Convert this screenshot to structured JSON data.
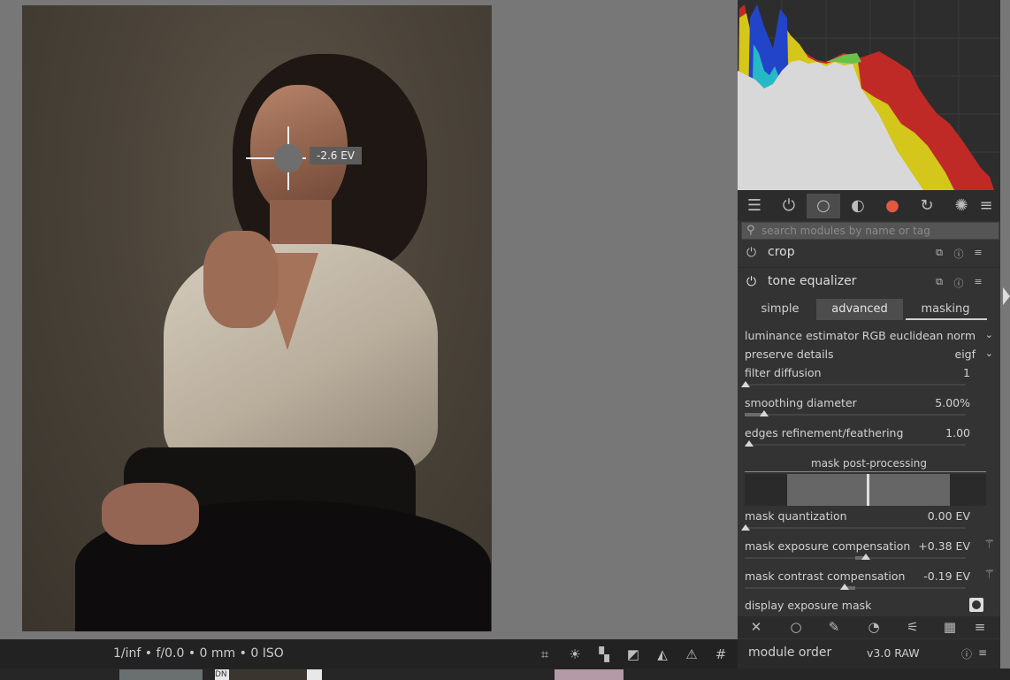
{
  "image": {
    "ev_readout": "-2.6 EV"
  },
  "statusbar": {
    "exif": "1/inf • f/0.0 • 0 mm • 0 ISO",
    "icons": [
      "focus-peaking-icon",
      "color-assessment-icon",
      "raw-overexposed-icon",
      "clipping-icon",
      "softproof-icon",
      "gamut-check-icon",
      "guides-icon"
    ]
  },
  "groups": {
    "icons": [
      "quick-access-icon",
      "active-modules-icon",
      "base-group-icon",
      "tone-group-icon",
      "color-group-icon",
      "correct-group-icon",
      "effects-group-icon",
      "presets-menu-icon"
    ],
    "active": "base-group-icon"
  },
  "search": {
    "placeholder": "search modules by name or tag"
  },
  "modules": {
    "crop": {
      "name": "crop"
    },
    "tone_equalizer": {
      "name": "tone equalizer"
    }
  },
  "tabs": {
    "simple": "simple",
    "advanced": "advanced",
    "masking": "masking",
    "active": "masking"
  },
  "params": {
    "luminance_estimator": {
      "label": "luminance estimator",
      "value": "RGB euclidean norm"
    },
    "preserve_details": {
      "label": "preserve details",
      "value": "eigf"
    },
    "filter_diffusion": {
      "label": "filter diffusion",
      "value": "1"
    },
    "smoothing_diameter": {
      "label": "smoothing diameter",
      "value": "5.00%"
    },
    "edges_refinement": {
      "label": "edges refinement/feathering",
      "value": "1.00"
    },
    "mask_post_processing": "mask post-processing",
    "mask_quantization": {
      "label": "mask quantization",
      "value": "0.00 EV"
    },
    "mask_exposure_comp": {
      "label": "mask exposure compensation",
      "value": "+0.38 EV"
    },
    "mask_contrast_comp": {
      "label": "mask contrast compensation",
      "value": "-0.19 EV"
    },
    "display_exposure_mask": {
      "label": "display exposure mask"
    }
  },
  "module_order": {
    "label": "module order",
    "value": "v3.0 RAW"
  },
  "filmstrip": {
    "thumb_label": "DN"
  },
  "colors": {
    "panel_bg": "#333333",
    "center_bg": "#777777",
    "hist_gray": "#d8d8d8",
    "hist_yellow": "#d4c61a",
    "hist_red": "#c02a26",
    "hist_blue": "#2244c8",
    "hist_cyan": "#27b8c6"
  }
}
